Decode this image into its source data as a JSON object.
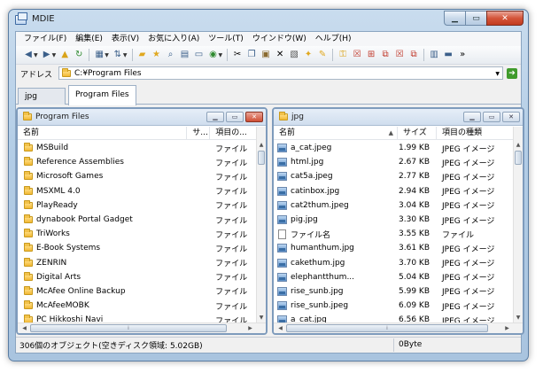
{
  "window": {
    "title": "MDIE"
  },
  "menu": [
    "ファイル(F)",
    "編集(E)",
    "表示(V)",
    "お気に入り(A)",
    "ツール(T)",
    "ウインドウ(W)",
    "ヘルプ(H)"
  ],
  "toolbar": {
    "icons": [
      "back-icon",
      "forward-icon",
      "up-folder-icon",
      "refresh-icon",
      "view-icon",
      "sort-icon",
      "folder-icon",
      "favorite-icon",
      "search-icon",
      "card-icon",
      "drive-icon",
      "globe-icon",
      "cut-icon",
      "copy-icon",
      "paste-icon",
      "delete-icon",
      "properties-icon",
      "new-folder-icon",
      "rename-icon",
      "lock-icon",
      "close-window-icon",
      "tile-icon",
      "cascade-icon",
      "close-all-icon",
      "cascade-2-icon",
      "layout-icon",
      "minimize-all-icon"
    ],
    "overflow": "»"
  },
  "address": {
    "label": "アドレス",
    "value": "C:¥Program Files"
  },
  "tabs": [
    "jpg",
    "Program Files"
  ],
  "left_pane": {
    "title": "Program Files",
    "columns": [
      "名前",
      "サ...",
      "項目の..."
    ],
    "rows": [
      {
        "name": "MSBuild",
        "type": "ファイル"
      },
      {
        "name": "Reference Assemblies",
        "type": "ファイル"
      },
      {
        "name": "Microsoft Games",
        "type": "ファイル"
      },
      {
        "name": "MSXML 4.0",
        "type": "ファイル"
      },
      {
        "name": "PlayReady",
        "type": "ファイル"
      },
      {
        "name": "dynabook Portal Gadget",
        "type": "ファイル"
      },
      {
        "name": "TriWorks",
        "type": "ファイル"
      },
      {
        "name": "E-Book Systems",
        "type": "ファイル"
      },
      {
        "name": "ZENRIN",
        "type": "ファイル"
      },
      {
        "name": "Digital Arts",
        "type": "ファイル"
      },
      {
        "name": "McAfee Online Backup",
        "type": "ファイル"
      },
      {
        "name": "McAfeeMOBK",
        "type": "ファイル"
      },
      {
        "name": "PC Hikkoshi Navi",
        "type": "ファイル"
      }
    ]
  },
  "right_pane": {
    "title": "jpg",
    "columns": [
      "名前",
      "サイズ",
      "項目の種類"
    ],
    "rows": [
      {
        "name": "a_cat.jpeg",
        "size": "1.99 KB",
        "type": "JPEG イメージ",
        "icon": "image"
      },
      {
        "name": "html.jpg",
        "size": "2.67 KB",
        "type": "JPEG イメージ",
        "icon": "image"
      },
      {
        "name": "cat5a.jpeg",
        "size": "2.77 KB",
        "type": "JPEG イメージ",
        "icon": "image"
      },
      {
        "name": "catinbox.jpg",
        "size": "2.94 KB",
        "type": "JPEG イメージ",
        "icon": "image"
      },
      {
        "name": "cat2thum.jpeg",
        "size": "3.04 KB",
        "type": "JPEG イメージ",
        "icon": "image"
      },
      {
        "name": "pig.jpg",
        "size": "3.30 KB",
        "type": "JPEG イメージ",
        "icon": "image"
      },
      {
        "name": "ファイル名",
        "size": "3.55 KB",
        "type": "ファイル",
        "icon": "file"
      },
      {
        "name": "humanthum.jpg",
        "size": "3.61 KB",
        "type": "JPEG イメージ",
        "icon": "image"
      },
      {
        "name": "cakethum.jpg",
        "size": "3.70 KB",
        "type": "JPEG イメージ",
        "icon": "image"
      },
      {
        "name": "elephantthum...",
        "size": "5.04 KB",
        "type": "JPEG イメージ",
        "icon": "image"
      },
      {
        "name": "rise_sunb.jpg",
        "size": "5.99 KB",
        "type": "JPEG イメージ",
        "icon": "image"
      },
      {
        "name": "rise_sunb.jpeg",
        "size": "6.09 KB",
        "type": "JPEG イメージ",
        "icon": "image"
      },
      {
        "name": "a_cat.jpg",
        "size": "6.56 KB",
        "type": "JPEG イメージ",
        "icon": "image"
      }
    ]
  },
  "status": {
    "left": "306個のオブジェクト(空きディスク領域: 5.02GB)",
    "right": "0Byte"
  },
  "colors": {
    "accent": "#7e9bbc",
    "close": "#cf4d33",
    "folder": "#f2b833"
  }
}
